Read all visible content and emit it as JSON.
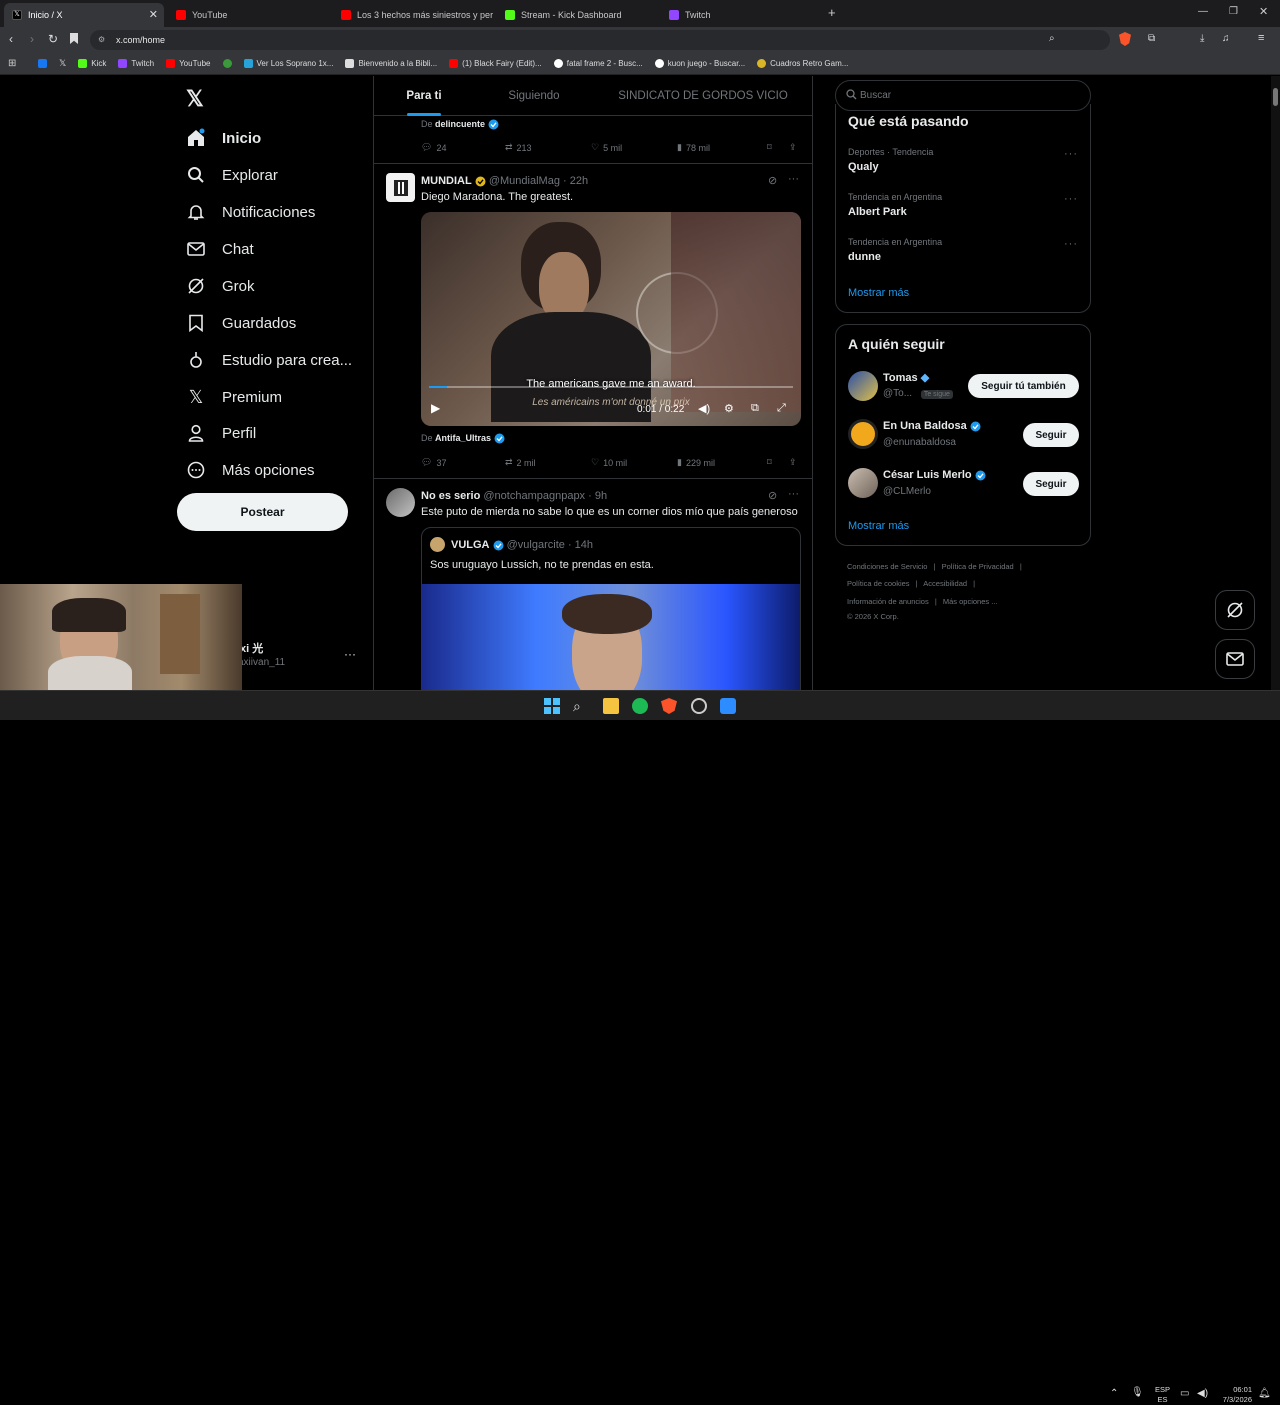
{
  "browser": {
    "tabs": [
      {
        "title": "Inicio / X",
        "active": true
      },
      {
        "title": "YouTube"
      },
      {
        "title": "Los 3 hechos más siniestros y perturb"
      },
      {
        "title": "Stream - Kick Dashboard"
      },
      {
        "title": "Twitch"
      }
    ],
    "new_tab": "+",
    "url": "x.com/home",
    "bookmarks": [
      "Kick",
      "Twitch",
      "YouTube",
      "Ver Los Soprano 1x...",
      "Bienvenido a la Bibli...",
      "(1) Black Fairy (Edit)...",
      "fatal frame 2 - Busc...",
      "kuon juego - Buscar...",
      "Cuadros Retro Gam..."
    ]
  },
  "nav": {
    "items": [
      {
        "label": "Inicio",
        "icon": "home-icon",
        "active": true
      },
      {
        "label": "Explorar",
        "icon": "search-icon"
      },
      {
        "label": "Notificaciones",
        "icon": "bell-icon"
      },
      {
        "label": "Chat",
        "icon": "mail-icon"
      },
      {
        "label": "Grok",
        "icon": "grok-icon"
      },
      {
        "label": "Guardados",
        "icon": "bookmark-icon"
      },
      {
        "label": "Estudio para crea...",
        "icon": "creator-studio-icon"
      },
      {
        "label": "Premium",
        "icon": "x-logo-icon"
      },
      {
        "label": "Perfil",
        "icon": "person-icon"
      },
      {
        "label": "Más opciones",
        "icon": "more-circle-icon"
      }
    ],
    "post_button": "Postear",
    "account": {
      "name": "xi 光",
      "handle": "axiivan_11"
    }
  },
  "timeline": {
    "tabs": [
      "Para ti",
      "Siguiendo",
      "SINDICATO DE GORDOS VICIO"
    ],
    "prev_tweet": {
      "attribution_prefix": "De",
      "attribution": "delincuente",
      "replies": "24",
      "reposts": "213",
      "likes": "5 mil",
      "views": "78 mil"
    },
    "tweet1": {
      "name": "MUNDIAL",
      "handle": "@MundialMag",
      "time": "· 22h",
      "text": "Diego Maradona. The greatest.",
      "video": {
        "subtitle_en": "The americans gave me an award.",
        "subtitle_fr": "Les américains m'ont donné un prix",
        "time": "0:01 / 0:22",
        "progress": 0.05
      },
      "attribution_prefix": "De",
      "attribution": "Antifa_Ultras",
      "replies": "37",
      "reposts": "2 mil",
      "likes": "10 mil",
      "views": "229 mil"
    },
    "tweet2": {
      "name": "No es serio",
      "handle": "@notchampagnpapx",
      "time": "· 9h",
      "text": "Este puto de mierda no sabe lo que es un corner dios mío que país generoso",
      "quote": {
        "name": "VULGA",
        "handle": "@vulgarcite",
        "time": "· 14h",
        "text": "Sos uruguayo Lussich, no te prendas en esta."
      }
    }
  },
  "sidebar": {
    "search_placeholder": "Buscar",
    "trends_title": "Qué está pasando",
    "trends": [
      {
        "context": "Deportes · Tendencia",
        "name": "Qualy"
      },
      {
        "context": "Tendencia en Argentina",
        "name": "Albert Park"
      },
      {
        "context": "Tendencia en Argentina",
        "name": "dunne"
      }
    ],
    "trends_more": "Mostrar más",
    "who_to_follow_title": "A quién seguir",
    "suggestions": [
      {
        "name": "Tomas",
        "handle": "@To...",
        "badge": "Te sigue",
        "button": "Seguir tú también"
      },
      {
        "name": "En Una Baldosa",
        "handle": "@enunabaldosa",
        "button": "Seguir"
      },
      {
        "name": "César Luis Merlo",
        "handle": "@CLMerlo",
        "button": "Seguir"
      }
    ],
    "follow_more": "Mostrar más",
    "footer": [
      "Condiciones de Servicio",
      "Política de Privacidad",
      "Política de cookies",
      "Accesibilidad",
      "Información de anuncios",
      "Más opciones ...",
      "© 2026 X Corp."
    ]
  },
  "taskbar": {
    "lang": "ESP",
    "lang2": "ES",
    "time": "06:01",
    "date": "7/3/2026"
  },
  "colors": {
    "accent": "#1d9bf0",
    "gold": "#e2b719",
    "bg": "#000000"
  }
}
